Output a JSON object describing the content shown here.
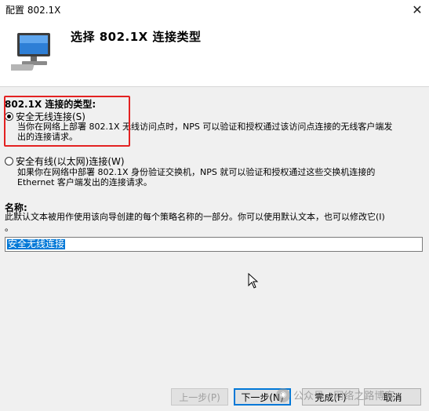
{
  "window": {
    "title": "配置 802.1X",
    "close_glyph": "✕"
  },
  "header": {
    "heading": "选择 802.1X 连接类型",
    "icon": "network-computer-icon"
  },
  "connection_type": {
    "label": "802.1X 连接的类型:",
    "options": [
      {
        "label": "安全无线连接(S)",
        "checked": true,
        "description_line1": "当你在网络上部署 802.1X 无线访问点时，NPS 可以验证和授权通过该访问点连接的无线客户端发",
        "description_line2": "出的连接请求。"
      },
      {
        "label": "安全有线(以太网)连接(W)",
        "checked": false,
        "description_line1": "如果你在网络中部署 802.1X 身份验证交换机，NPS 就可以验证和授权通过这些交换机连接的",
        "description_line2": "Ethernet 客户端发出的连接请求。"
      }
    ]
  },
  "name_section": {
    "label": "名称:",
    "help_line1": "此默认文本被用作使用该向导创建的每个策略名称的一部分。你可以使用默认文本，也可以修改它(I)",
    "help_line2": "。",
    "value": "安全无线连接"
  },
  "buttons": {
    "back": "上一步(P)",
    "next": "下一步(N)",
    "finish": "完成(F)",
    "cancel": "取消"
  },
  "watermark": {
    "text": "公众号 · 网络之路博客"
  },
  "colors": {
    "highlight_border": "#e32121",
    "selection": "#0078d7"
  }
}
